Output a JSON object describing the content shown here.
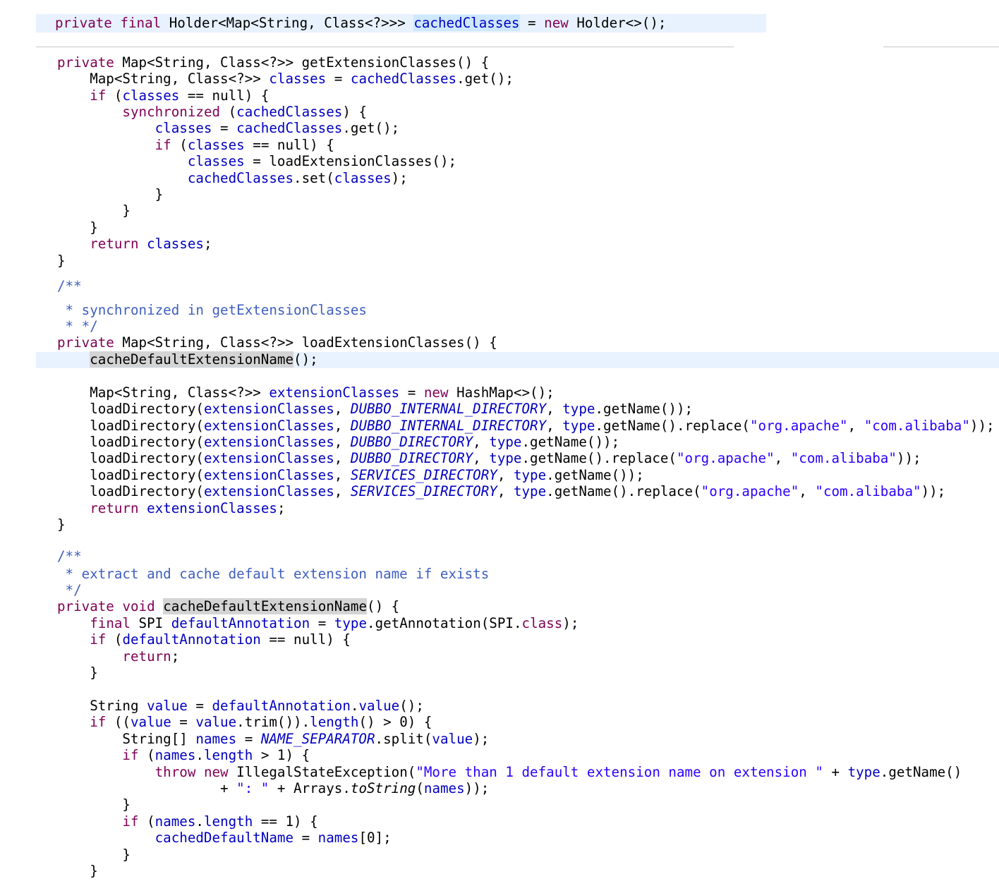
{
  "editor": {
    "lines": [
      {
        "text": "private final Holder<Map<String, Class<?>>> cachedClasses = new Holder<>();"
      },
      {
        "text": "private Map<String, Class<?>> getExtensionClasses() {"
      },
      {
        "text": "    Map<String, Class<?>> classes = cachedClasses.get();"
      },
      {
        "text": "    if (classes == null) {"
      },
      {
        "text": "        synchronized (cachedClasses) {"
      },
      {
        "text": "            classes = cachedClasses.get();"
      },
      {
        "text": "            if (classes == null) {"
      },
      {
        "text": "                classes = loadExtensionClasses();"
      },
      {
        "text": "                cachedClasses.set(classes);"
      },
      {
        "text": "            }"
      },
      {
        "text": "        }"
      },
      {
        "text": "    }"
      },
      {
        "text": "    return classes;"
      },
      {
        "text": "}"
      },
      {
        "text": "/**"
      },
      {
        "text": " * synchronized in getExtensionClasses"
      },
      {
        "text": " * */"
      },
      {
        "text": "private Map<String, Class<?>> loadExtensionClasses() {"
      },
      {
        "text": "    cacheDefaultExtensionName();"
      },
      {
        "text": "    Map<String, Class<?>> extensionClasses = new HashMap<>();"
      },
      {
        "text": "    loadDirectory(extensionClasses, DUBBO_INTERNAL_DIRECTORY, type.getName());"
      },
      {
        "text": "    loadDirectory(extensionClasses, DUBBO_INTERNAL_DIRECTORY, type.getName().replace(\"org.apache\", \"com.alibaba\"));"
      },
      {
        "text": "    loadDirectory(extensionClasses, DUBBO_DIRECTORY, type.getName());"
      },
      {
        "text": "    loadDirectory(extensionClasses, DUBBO_DIRECTORY, type.getName().replace(\"org.apache\", \"com.alibaba\"));"
      },
      {
        "text": "    loadDirectory(extensionClasses, SERVICES_DIRECTORY, type.getName());"
      },
      {
        "text": "    loadDirectory(extensionClasses, SERVICES_DIRECTORY, type.getName().replace(\"org.apache\", \"com.alibaba\"));"
      },
      {
        "text": "    return extensionClasses;"
      },
      {
        "text": "}"
      },
      {
        "text": "/**"
      },
      {
        "text": " * extract and cache default extension name if exists"
      },
      {
        "text": " */"
      },
      {
        "text": "private void cacheDefaultExtensionName() {"
      },
      {
        "text": "    final SPI defaultAnnotation = type.getAnnotation(SPI.class);"
      },
      {
        "text": "    if (defaultAnnotation == null) {"
      },
      {
        "text": "        return;"
      },
      {
        "text": "    }"
      },
      {
        "text": "    String value = defaultAnnotation.value();"
      },
      {
        "text": "    if ((value = value.trim()).length() > 0) {"
      },
      {
        "text": "        String[] names = NAME_SEPARATOR.split(value);"
      },
      {
        "text": "        if (names.length > 1) {"
      },
      {
        "text": "            throw new IllegalStateException(\"More than 1 default extension name on extension \" + type.getName()"
      },
      {
        "text": "                    + \": \" + Arrays.toString(names));"
      },
      {
        "text": "        }"
      },
      {
        "text": "        if (names.length == 1) {"
      },
      {
        "text": "            cachedDefaultName = names[0];"
      },
      {
        "text": "        }"
      },
      {
        "text": "    }"
      }
    ]
  }
}
